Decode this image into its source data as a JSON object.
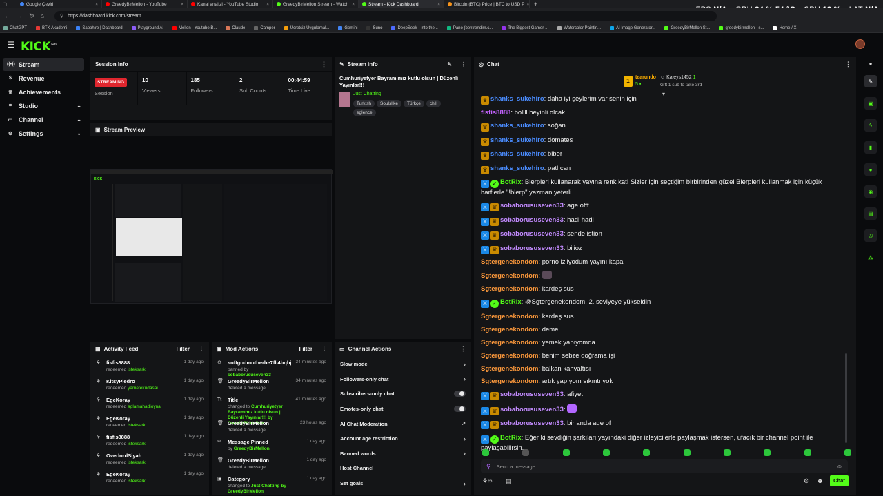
{
  "browser": {
    "tabs": [
      {
        "label": "Google Çeviri",
        "color": "#4285f4"
      },
      {
        "label": "GreedyBirMellon - YouTube",
        "color": "#ff0000"
      },
      {
        "label": "Kanal analizi - YouTube Studio",
        "color": "#ff0000"
      },
      {
        "label": "GreedyBirMellon Stream - Watch",
        "color": "#53fc18"
      },
      {
        "label": "Stream - Kick Dashboard",
        "color": "#53fc18"
      },
      {
        "label": "Bitcoin (BTC) Price | BTC to USD P",
        "color": "#f7931a"
      }
    ],
    "url": "https://dashboard.kick.com/stream",
    "bookmarks": [
      "ChatGPT",
      "BTK Akademi",
      "Sapphire | Dashboard",
      "Playground AI",
      "Mellon - Youtube B...",
      "Claude",
      "Camper",
      "Ücretsiz Uygulamal...",
      "Gemini",
      "Suno",
      "DeepSeek - Into the...",
      "Pano (bentrendim.c...",
      "The Biggest Gamer-...",
      "Watercolor Paintin...",
      "AI Image Generator...",
      "GreedyBirMellon St...",
      "greedybirmellon - s...",
      "Home / X"
    ],
    "perf": {
      "fps_label": "FPS",
      "fps": "N/A",
      "gpu_label": "GPU",
      "gpu": "34 % 54 °C",
      "cpu_label": "CPU",
      "cpu": "12 %",
      "lat_label": "LAT",
      "lat": "N/A"
    }
  },
  "app": {
    "logo": "KICK",
    "logo_sup": "beta"
  },
  "sidebar": {
    "items": [
      {
        "label": "Stream",
        "icon": "radio-icon"
      },
      {
        "label": "Revenue",
        "icon": "money-icon"
      },
      {
        "label": "Achievements",
        "icon": "trophy-icon"
      },
      {
        "label": "Studio",
        "icon": "studio-icon"
      },
      {
        "label": "Channel",
        "icon": "channel-icon"
      },
      {
        "label": "Settings",
        "icon": "gear-icon"
      }
    ]
  },
  "session": {
    "title": "Session Info",
    "status": "STREAMING",
    "status_caption": "Session",
    "stats": [
      {
        "value": "10",
        "label": "Viewers"
      },
      {
        "value": "185",
        "label": "Followers"
      },
      {
        "value": "2",
        "label": "Sub Counts"
      },
      {
        "value": "00:44:59",
        "label": "Time Live"
      }
    ]
  },
  "preview": {
    "title": "Stream Preview"
  },
  "streaminfo": {
    "title": "Stream info",
    "stream_title": "Cumhuriyetyer Bayramımız kutlu olsun | Düzenli Yayınlar!!!",
    "category": "Just Chatting",
    "tags": [
      "Turkish",
      "Soulslike",
      "Türkçe",
      "chill",
      "eglence"
    ]
  },
  "activity": {
    "title": "Activity Feed",
    "filter": "Filter",
    "items": [
      {
        "name": "fisfis8888",
        "action": "redeemed",
        "reward": "isteksarkı",
        "time": "1 day ago"
      },
      {
        "name": "KitsyPiedro",
        "action": "redeemed",
        "reward": "yametekudasai",
        "time": "1 day ago"
      },
      {
        "name": "EgeKoray",
        "action": "redeemed",
        "reward": "aglamahadioyna",
        "time": "1 day ago"
      },
      {
        "name": "EgeKoray",
        "action": "redeemed",
        "reward": "isteksarkı",
        "time": "1 day ago"
      },
      {
        "name": "fisfis8888",
        "action": "redeemed",
        "reward": "isteksarkı",
        "time": "1 day ago"
      },
      {
        "name": "OverlordSiyah",
        "action": "redeemed",
        "reward": "isteksarkı",
        "time": "1 day ago"
      },
      {
        "name": "EgeKoray",
        "action": "redeemed",
        "reward": "isteksarkı",
        "time": "1 day ago"
      }
    ]
  },
  "modactions": {
    "title": "Mod Actions",
    "filter": "Filter",
    "items": [
      {
        "name": "softgodmotherhe7fli4bqbj",
        "line": "banned by",
        "by": "sobaborususeven33",
        "time": "34 minutes ago",
        "icon": "ban-icon"
      },
      {
        "name": "GreedyBirMellon",
        "line": "deleted a message",
        "by": "",
        "time": "34 minutes ago",
        "icon": "trash-icon"
      },
      {
        "name": "Title",
        "line": "changed to",
        "by": "Cumhuriyetyer Bayramımız kutlu olsun | Düzenli Yayınlar!!! by GreedyBirMellon",
        "time": "41 minutes ago",
        "icon": "title-icon"
      },
      {
        "name": "GreedyBirMellon",
        "line": "deleted a message",
        "by": "",
        "time": "23 hours ago",
        "icon": "trash-icon"
      },
      {
        "name": "Message Pinned",
        "line": "by",
        "by": "GreedyBirMellon",
        "time": "1 day ago",
        "icon": "pin-icon"
      },
      {
        "name": "GreedyBirMellon",
        "line": "deleted a message",
        "by": "",
        "time": "1 day ago",
        "icon": "trash-icon"
      },
      {
        "name": "Category",
        "line": "changed to",
        "by": "Just Chatting by GreedyBirMellon",
        "time": "1 day ago",
        "icon": "category-icon"
      }
    ]
  },
  "channelactions": {
    "title": "Channel Actions",
    "items": [
      {
        "label": "Slow mode",
        "control": "chevron"
      },
      {
        "label": "Followers-only chat",
        "control": "chevron"
      },
      {
        "label": "Subscribers-only chat",
        "control": "toggle"
      },
      {
        "label": "Emotes-only chat",
        "control": "toggle"
      },
      {
        "label": "AI Chat Moderation",
        "control": "external"
      },
      {
        "label": "Account age restriction",
        "control": "chevron"
      },
      {
        "label": "Banned words",
        "control": "chevron"
      },
      {
        "label": "Host Channel",
        "control": "none"
      },
      {
        "label": "Set goals",
        "control": "chevron"
      }
    ]
  },
  "chat": {
    "title": "Chat",
    "leader": {
      "rank": "1",
      "name": "tearundo",
      "count": "5",
      "second": "Kaleys1452",
      "second_count": "1",
      "gift_text": "Gift 1 sub to take 3rd"
    },
    "messages": [
      {
        "user": "shanks_sukehiro",
        "color": "#4a8cff",
        "badges": [
          "crown"
        ],
        "text": "daha iyi şeylerim var senin için"
      },
      {
        "user": "fisfis8888",
        "color": "#c463ff",
        "badges": [],
        "text": "bollll beyinli olcak"
      },
      {
        "user": "shanks_sukehiro",
        "color": "#4a8cff",
        "badges": [
          "crown"
        ],
        "text": "soğan"
      },
      {
        "user": "shanks_sukehiro",
        "color": "#4a8cff",
        "badges": [
          "crown"
        ],
        "text": "domates"
      },
      {
        "user": "shanks_sukehiro",
        "color": "#4a8cff",
        "badges": [
          "crown"
        ],
        "text": "biber"
      },
      {
        "user": "shanks_sukehiro",
        "color": "#4a8cff",
        "badges": [
          "crown"
        ],
        "text": "patlıcan"
      },
      {
        "user": "BotRix",
        "color": "#53fc18",
        "badges": [
          "mod",
          "verified"
        ],
        "text": "Blerpleri kullanarak yayına renk kat! Sizler için seçtiğim birbirinden güzel Blerpleri kullanmak için küçük harflerle \"!blerp\" yazman yeterli."
      },
      {
        "user": "sobaborususeven33",
        "color": "#c38bff",
        "badges": [
          "mod",
          "crown"
        ],
        "text": "age offf"
      },
      {
        "user": "sobaborususeven33",
        "color": "#c38bff",
        "badges": [
          "mod",
          "crown"
        ],
        "text": "hadi hadi"
      },
      {
        "user": "sobaborususeven33",
        "color": "#c38bff",
        "badges": [
          "mod",
          "crown"
        ],
        "text": "sende istion"
      },
      {
        "user": "sobaborususeven33",
        "color": "#c38bff",
        "badges": [
          "mod",
          "crown"
        ],
        "text": "bilioz"
      },
      {
        "user": "Sgtergenekondom",
        "color": "#ff9a3c",
        "badges": [],
        "text": "porno izliyodum yayını kapa"
      },
      {
        "user": "Sgtergenekondom",
        "color": "#ff9a3c",
        "badges": [],
        "text": ""
      },
      {
        "user": "Sgtergenekondom",
        "color": "#ff9a3c",
        "badges": [],
        "text": "kardeş sus"
      },
      {
        "user": "BotRix",
        "color": "#53fc18",
        "badges": [
          "mod",
          "verified"
        ],
        "text": "@Sgtergenekondom, 2. seviyeye yükseldin"
      },
      {
        "user": "Sgtergenekondom",
        "color": "#ff9a3c",
        "badges": [],
        "text": "kardeş sus"
      },
      {
        "user": "Sgtergenekondom",
        "color": "#ff9a3c",
        "badges": [],
        "text": "deme"
      },
      {
        "user": "Sgtergenekondom",
        "color": "#ff9a3c",
        "badges": [],
        "text": "yemek yapıyomda"
      },
      {
        "user": "Sgtergenekondom",
        "color": "#ff9a3c",
        "badges": [],
        "text": "benim sebze doğrama işi"
      },
      {
        "user": "Sgtergenekondom",
        "color": "#ff9a3c",
        "badges": [],
        "text": "balkan kahvaltısı"
      },
      {
        "user": "Sgtergenekondom",
        "color": "#ff9a3c",
        "badges": [],
        "text": "artık yapıyom sıkıntı yok"
      },
      {
        "user": "sobaborususeven33",
        "color": "#c38bff",
        "badges": [
          "mod",
          "crown"
        ],
        "text": "afiyet"
      },
      {
        "user": "sobaborususeven33",
        "color": "#c38bff",
        "badges": [
          "mod",
          "crown"
        ],
        "text": ""
      },
      {
        "user": "sobaborususeven33",
        "color": "#c38bff",
        "badges": [
          "mod",
          "crown"
        ],
        "text": "bir anda age of"
      },
      {
        "user": "BotRix",
        "color": "#53fc18",
        "badges": [
          "mod",
          "verified"
        ],
        "text": "Eğer ki sevdiğin şarkıları yayındaki diğer izleyicilerle paylaşmak istersen, ufacık bir channel point ile paylaşabilirsin."
      }
    ],
    "placeholder": "Send a message",
    "send_label": "Chat"
  },
  "colors": {
    "accent": "#53fc18",
    "panel": "#141517",
    "bg": "#0a0b0d",
    "streaming": "#e0262e"
  }
}
